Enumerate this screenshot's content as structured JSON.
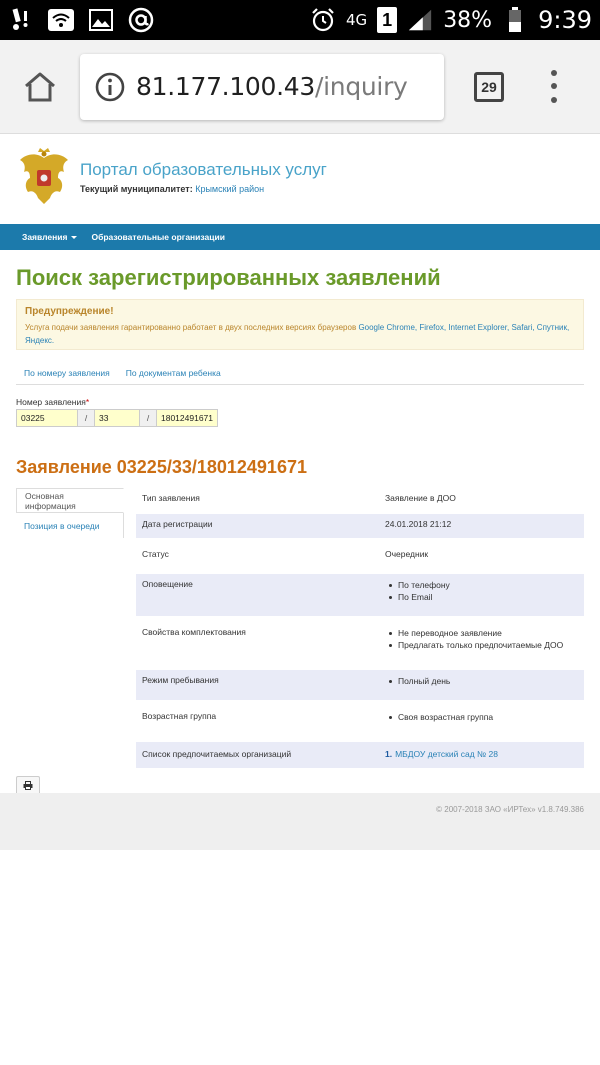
{
  "statusbar": {
    "battery_percent": "38%",
    "network": "4G",
    "sim_slot": "1",
    "time": "9:39",
    "icons": [
      "notification-icon",
      "wifi-icon",
      "image-icon",
      "at-icon",
      "alarm-icon",
      "signal-icon",
      "battery-icon"
    ]
  },
  "browser": {
    "url_host": "81.177.100.43",
    "url_path": "/inquiry",
    "tab_count": "29"
  },
  "header": {
    "portal_title": "Портал образовательных услуг",
    "municipality_label": "Текущий муниципалитет:",
    "municipality_value": "Крымский район"
  },
  "nav": {
    "items": [
      {
        "label": "Заявления"
      },
      {
        "label": "Образовательные организации"
      }
    ]
  },
  "main": {
    "title": "Поиск зарегистрированных заявлений",
    "warning": {
      "title": "Предупреждение!",
      "text_prefix": "Услуга подачи заявления гарантированно работает в двух последних версиях браузеров",
      "browsers": [
        "Google Chrome,",
        "Firefox,",
        "Internet Explorer,",
        "Safari,",
        "Спутник,",
        "Яндекс."
      ]
    },
    "search_tabs": [
      "По номеру заявления",
      "По документам ребенка"
    ],
    "number_label": "Номер заявления",
    "required_mark": "*",
    "number_parts": [
      "03225",
      "33",
      "18012491671"
    ],
    "separator": "/",
    "application_title": "Заявление 03225/33/18012491671",
    "side_tabs": [
      "Основная информация",
      "Позиция в очереди"
    ],
    "rows": [
      {
        "label": "Тип заявления",
        "value": "Заявление в ДОО"
      },
      {
        "label": "Дата регистрации",
        "value": "24.01.2018 21:12"
      },
      {
        "label": "Статус",
        "value": "Очередник"
      },
      {
        "label": "Оповещение",
        "list": [
          "По телефону",
          "По Email"
        ]
      },
      {
        "label": "Свойства комплектования",
        "list": [
          "Не переводное заявление",
          "Предлагать только предпочитаемые ДОО"
        ]
      },
      {
        "label": "Режим пребывания",
        "list": [
          "Полный день"
        ]
      },
      {
        "label": "Возрастная группа",
        "list": [
          "Своя возрастная группа"
        ]
      },
      {
        "label": "Список предпочитаемых организаций",
        "org_num": "1.",
        "org_name": "МБДОУ детский сад № 28"
      }
    ]
  },
  "footer": {
    "copyright": "© 2007-2018 ЗАО «ИРТех» v1.8.749.386"
  },
  "colors": {
    "nav_bg": "#1c7aab",
    "title_green": "#6a9a2a",
    "app_title_orange": "#cc6f14",
    "link_blue": "#2a82b6",
    "row_alt": "#e9ebf7",
    "warning_bg": "#fcf8e3"
  }
}
